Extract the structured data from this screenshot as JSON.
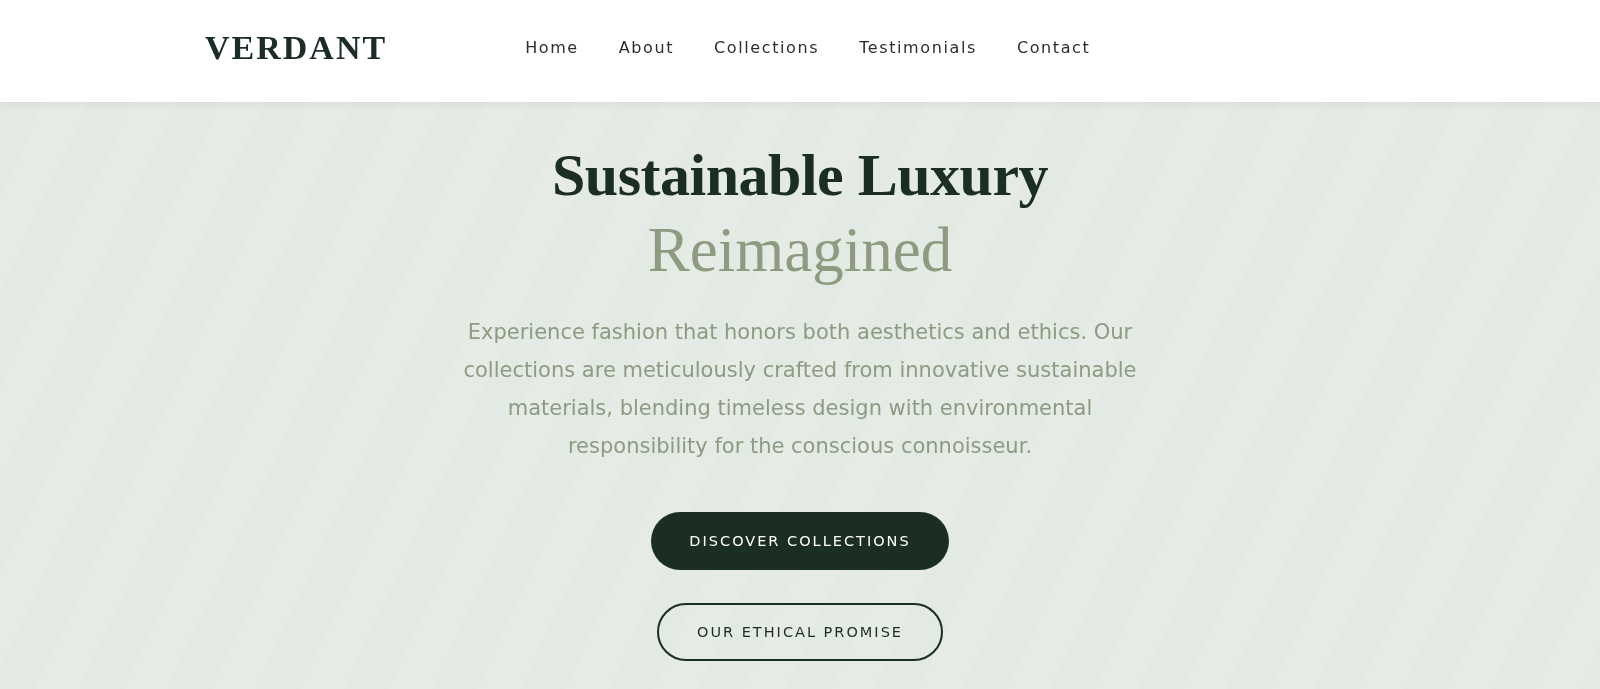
{
  "header": {
    "logo": "VERDANT",
    "nav": [
      {
        "label": "Home"
      },
      {
        "label": "About"
      },
      {
        "label": "Collections"
      },
      {
        "label": "Testimonials"
      },
      {
        "label": "Contact"
      }
    ]
  },
  "hero": {
    "title": "Sustainable Luxury",
    "title_accent": "Reimagined",
    "description": "Experience fashion that honors both aesthetics and ethics. Our collections are meticulously crafted from innovative sustainable materials, blending timeless design with environmental responsibility for the conscious connoisseur.",
    "buttons": [
      {
        "label": "DISCOVER COLLECTIONS",
        "kind": "primary"
      },
      {
        "label": "OUR ETHICAL PROMISE",
        "kind": "outline"
      }
    ]
  }
}
